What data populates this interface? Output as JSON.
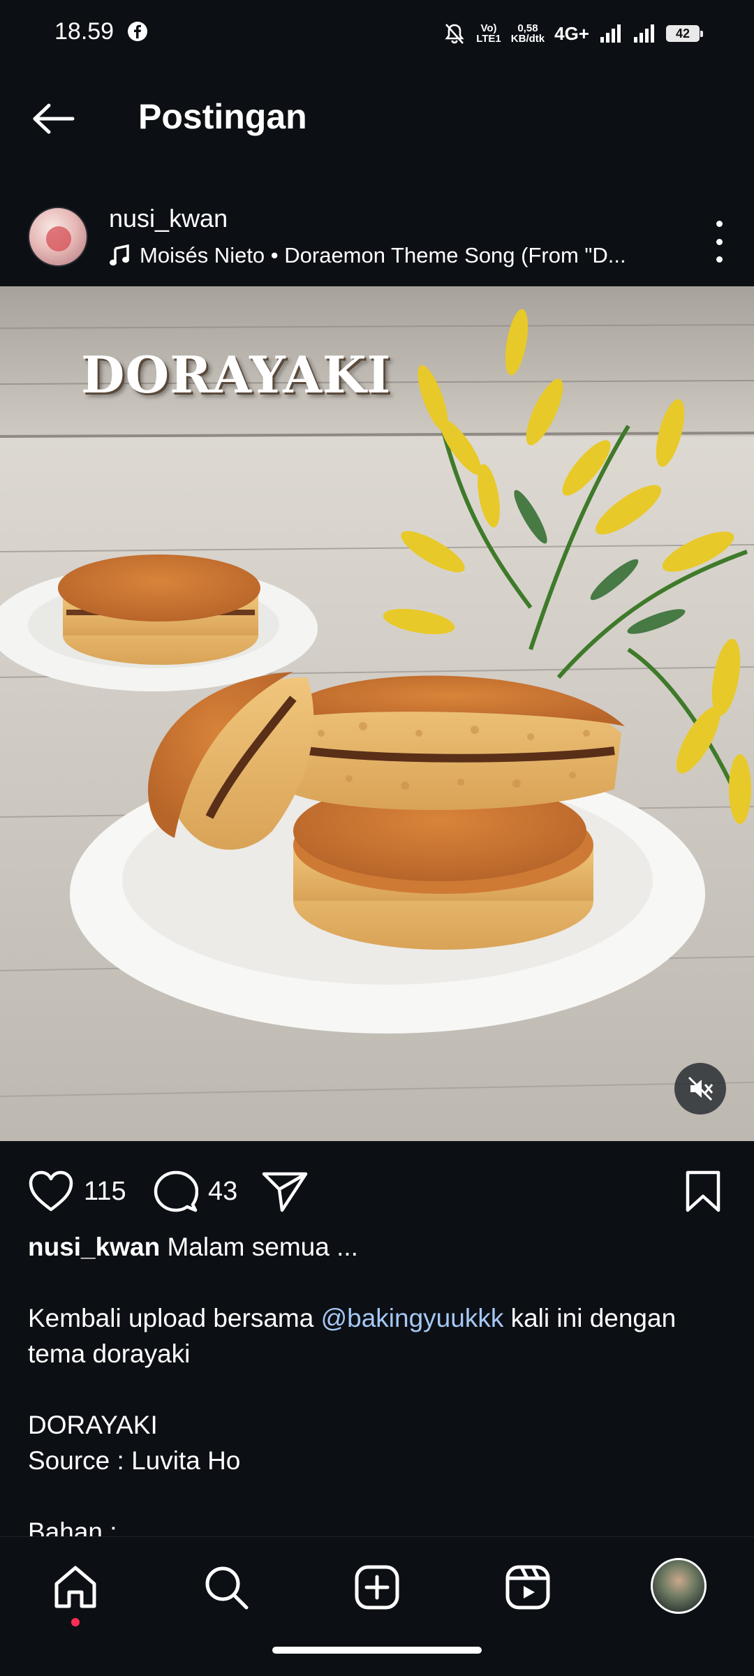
{
  "status_bar": {
    "time": "18.59",
    "volte_top": "Vo)",
    "volte_bottom": "LTE1",
    "speed_top": "0,58",
    "speed_bottom": "KB/dtk",
    "network": "4G+",
    "battery": "42"
  },
  "header": {
    "title": "Postingan"
  },
  "post": {
    "username": "nusi_kwan",
    "music": "Moisés Nieto • Doraemon Theme Song (From \"D...",
    "image_overlay_text": "DORAYAKI",
    "likes": "115",
    "comments": "43"
  },
  "caption": {
    "username": "nusi_kwan",
    "first_line": " Malam semua ...",
    "line2_pre": "Kembali upload bersama ",
    "mention": "@bakingyuukkk",
    "line2_post": " kali ini dengan tema dorayaki",
    "title": "DORAYAKI",
    "source": "Source : Luvita Ho",
    "bahan": "Bahan :"
  },
  "colors": {
    "background": "#0c0f14",
    "mention": "#a5c8f5",
    "notification_dot": "#ff2d55"
  },
  "icons": {
    "back": "arrow-left-icon",
    "more": "more-vertical-icon",
    "music": "music-note-icon",
    "like": "heart-icon",
    "comment": "comment-icon",
    "share": "send-icon",
    "save": "bookmark-icon",
    "mute": "speaker-muted-icon",
    "home": "home-icon",
    "search": "search-icon",
    "create": "plus-square-icon",
    "reels": "reels-icon"
  }
}
